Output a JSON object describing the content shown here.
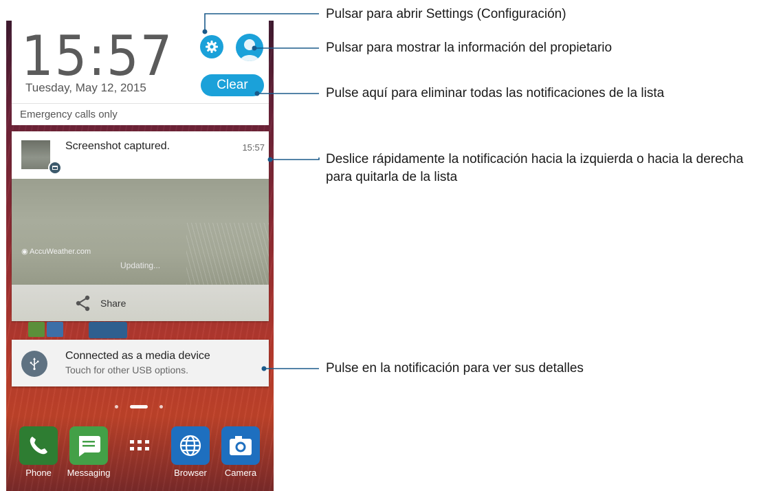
{
  "phone": {
    "clock": "15:57",
    "date": "Tuesday, May 12, 2015",
    "clear_label": "Clear",
    "emergency": "Emergency calls only",
    "notifications": {
      "screenshot": {
        "title": "Screenshot captured.",
        "time": "15:57",
        "preview_brand": "◉ AccuWeather.com",
        "preview_status": "Updating...",
        "share_label": "Share"
      },
      "usb": {
        "title": "Connected as a media device",
        "subtitle": "Touch for other USB options."
      }
    },
    "dock": [
      {
        "label": "Phone",
        "icon": "phone-icon",
        "color": "#2e7d32"
      },
      {
        "label": "Messaging",
        "icon": "messaging-icon",
        "color": "#4caf50"
      },
      {
        "label": "",
        "icon": "app-drawer-icon",
        "color": ""
      },
      {
        "label": "Browser",
        "icon": "browser-icon",
        "color": "#1e88e5"
      },
      {
        "label": "Camera",
        "icon": "camera-icon",
        "color": "#1e88e5"
      }
    ],
    "accent_color": "#1ba1d9"
  },
  "callouts": [
    {
      "text": "Pulsar para abrir Settings (Configuración)",
      "target": "settings"
    },
    {
      "text": "Pulsar para mostrar la información del propietario",
      "target": "owner"
    },
    {
      "text": "Pulse aquí para eliminar todas las notificaciones de la lista",
      "target": "clear"
    },
    {
      "text": "Deslice rápidamente la notificación hacia la izquierda o hacia la derecha para quitarla de la lista",
      "target": "notification"
    },
    {
      "text": "Pulse en la notificación para ver sus detalles",
      "target": "usb-notification"
    }
  ],
  "callout_line_color": "#1a5a8a"
}
